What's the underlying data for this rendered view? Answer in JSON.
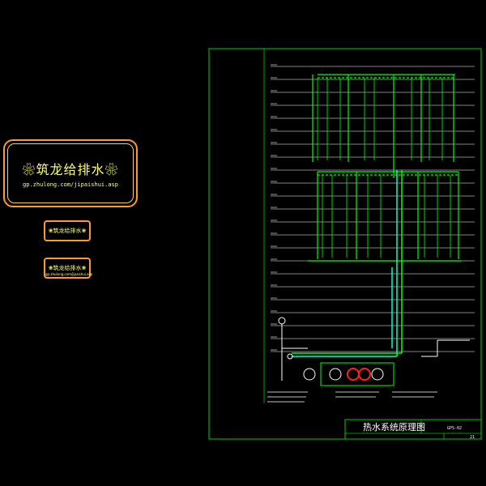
{
  "watermark": {
    "title": "❀筑龙给排水❀",
    "url": "gp.zhulong.com/jipaishui.asp",
    "badge1": "❀筑龙给排水❀",
    "badge2_title": "❀筑龙给排水❀",
    "badge2_sub": "gp.zhulong.com/jipaishui.asp"
  },
  "title_block": {
    "title": "热水系统原理图",
    "code": "GPS-02",
    "page": "21"
  },
  "colors": {
    "frame": "#00cc00",
    "pipe": "#00ff00",
    "riser": "#00ffcc",
    "floor_line": "#ffffff",
    "accent": "#ff9933",
    "text": "#ffff66",
    "equipment": "#ff2222"
  }
}
